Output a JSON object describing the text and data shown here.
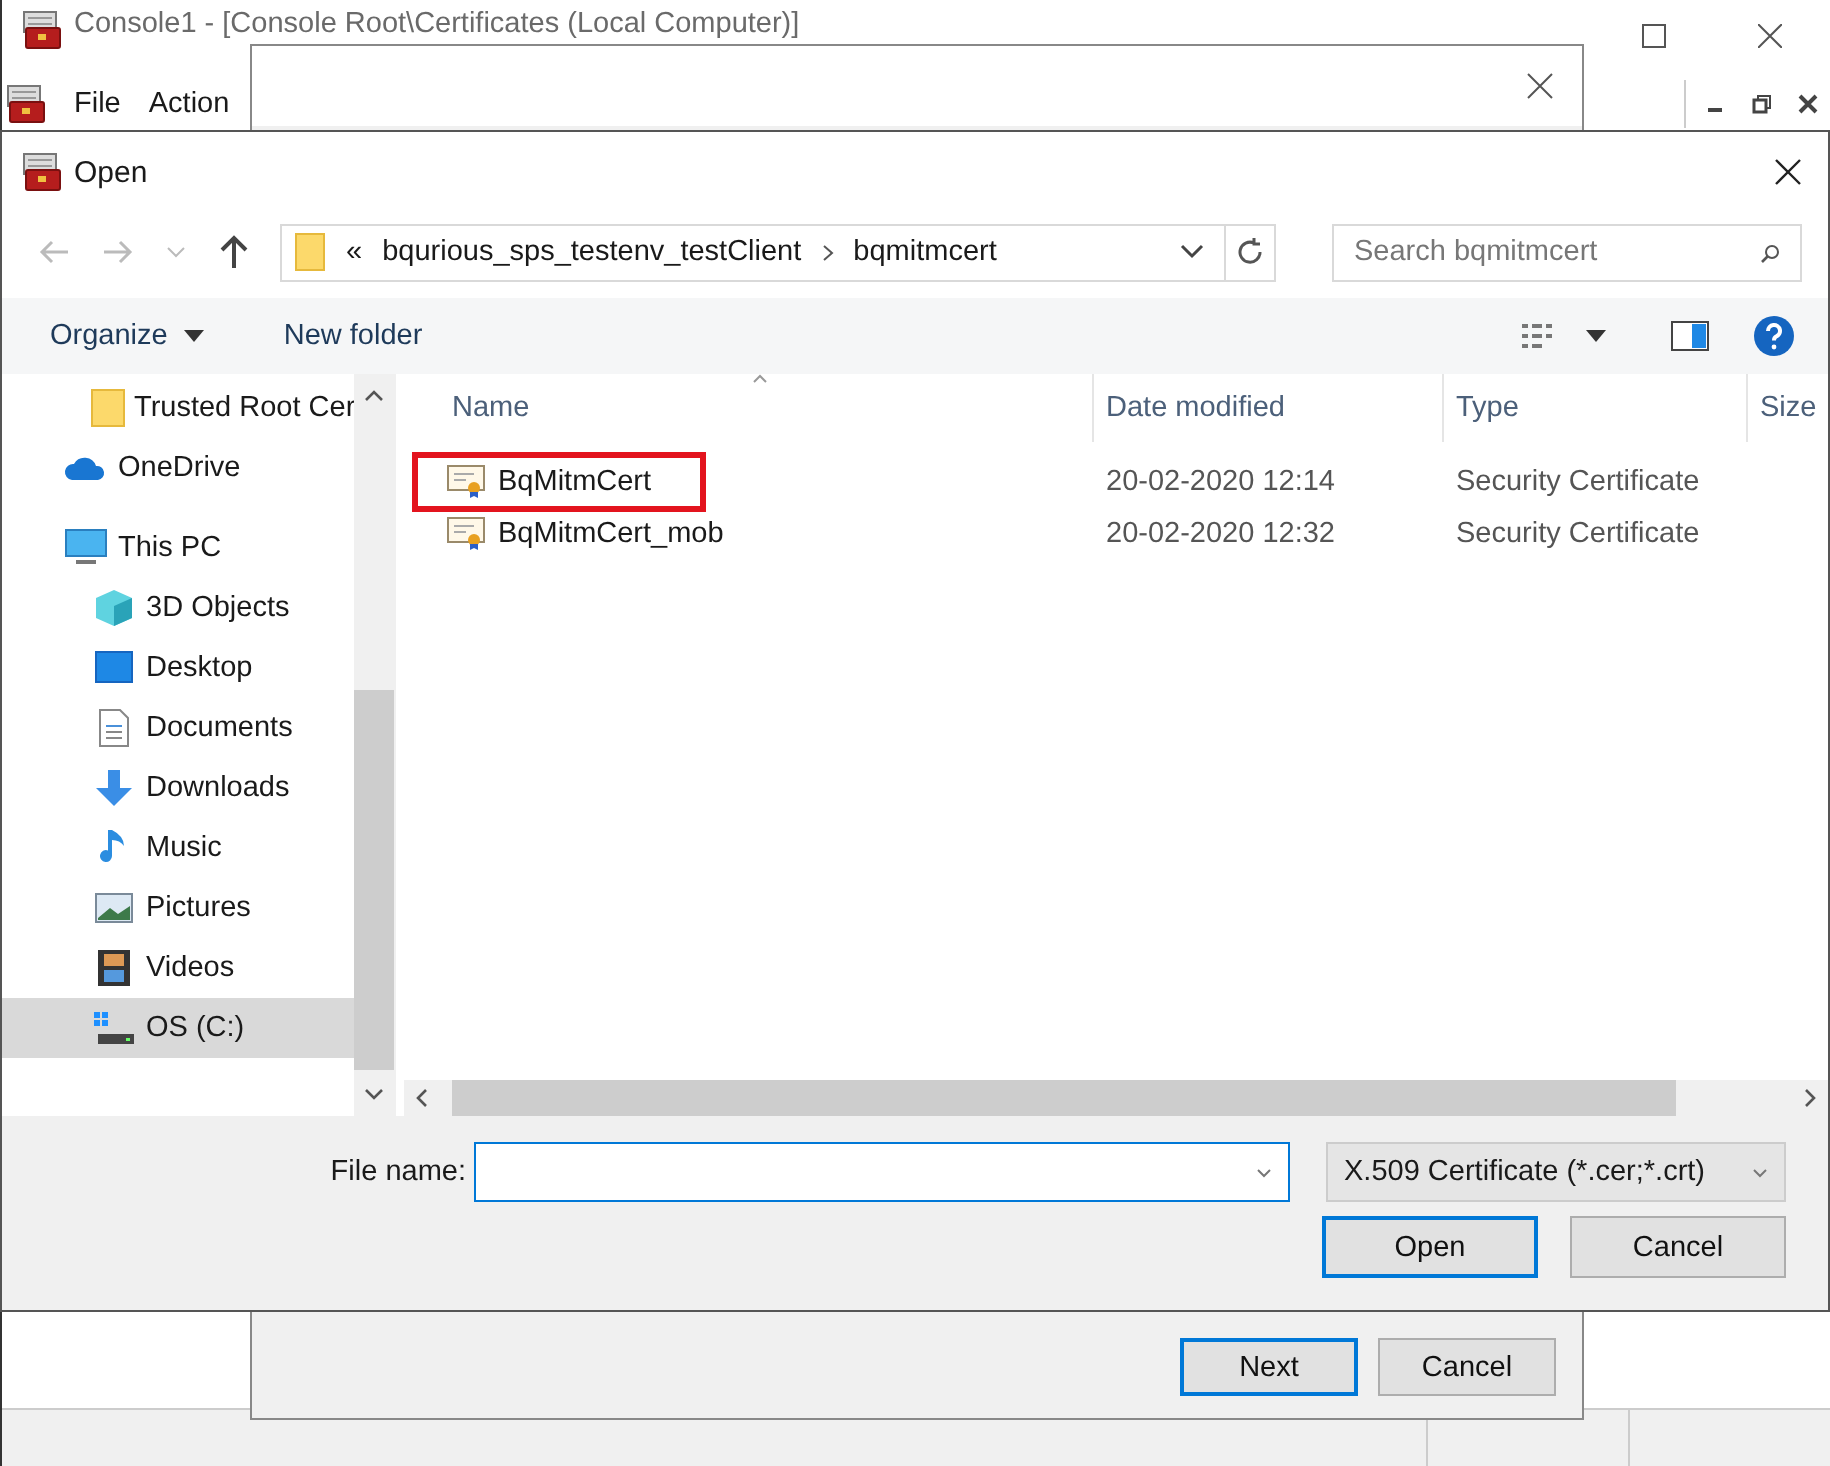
{
  "console": {
    "title": "Console1 - [Console Root\\Certificates (Local Computer)]",
    "menu": [
      "File",
      "Action"
    ]
  },
  "wizard": {
    "buttons": [
      {
        "label": "Next",
        "default": true
      },
      {
        "label": "Cancel",
        "default": false
      }
    ]
  },
  "dialog": {
    "title": "Open",
    "overflow": "«",
    "path": [
      "bqurious_sps_testenv_testClient",
      "bqmitmcert"
    ],
    "search": {
      "placeholder": "Search bqmitmcert"
    },
    "toolbar": {
      "organize": "Organize",
      "new_folder": "New folder"
    },
    "sidebar": {
      "items": [
        {
          "label": "Trusted Root Cer",
          "kind": "folder",
          "selected": false
        },
        {
          "label": "OneDrive",
          "kind": "cloud",
          "selected": false
        },
        {
          "label": "This PC",
          "kind": "pc",
          "selected": false,
          "children": [
            {
              "label": "3D Objects",
              "kind": "cube",
              "selected": false
            },
            {
              "label": "Desktop",
              "kind": "desktop",
              "selected": false
            },
            {
              "label": "Documents",
              "kind": "document",
              "selected": false
            },
            {
              "label": "Downloads",
              "kind": "download",
              "selected": false
            },
            {
              "label": "Music",
              "kind": "music",
              "selected": false
            },
            {
              "label": "Pictures",
              "kind": "picture",
              "selected": false
            },
            {
              "label": "Videos",
              "kind": "video",
              "selected": false
            },
            {
              "label": "OS (C:)",
              "kind": "drive",
              "selected": true
            }
          ]
        }
      ]
    },
    "columns": [
      "Name",
      "Date modified",
      "Type",
      "Size"
    ],
    "rows": [
      {
        "name": "BqMitmCert",
        "date": "20-02-2020 12:14",
        "type": "Security Certificate",
        "highlighted": true
      },
      {
        "name": "BqMitmCert_mob",
        "date": "20-02-2020 12:32",
        "type": "Security Certificate",
        "highlighted": false
      }
    ],
    "file_name_label": "File name:",
    "filter": "X.509 Certificate (*.cer;*.crt)",
    "buttons": [
      {
        "label": "Open",
        "default": true
      },
      {
        "label": "Cancel",
        "default": false
      }
    ]
  }
}
